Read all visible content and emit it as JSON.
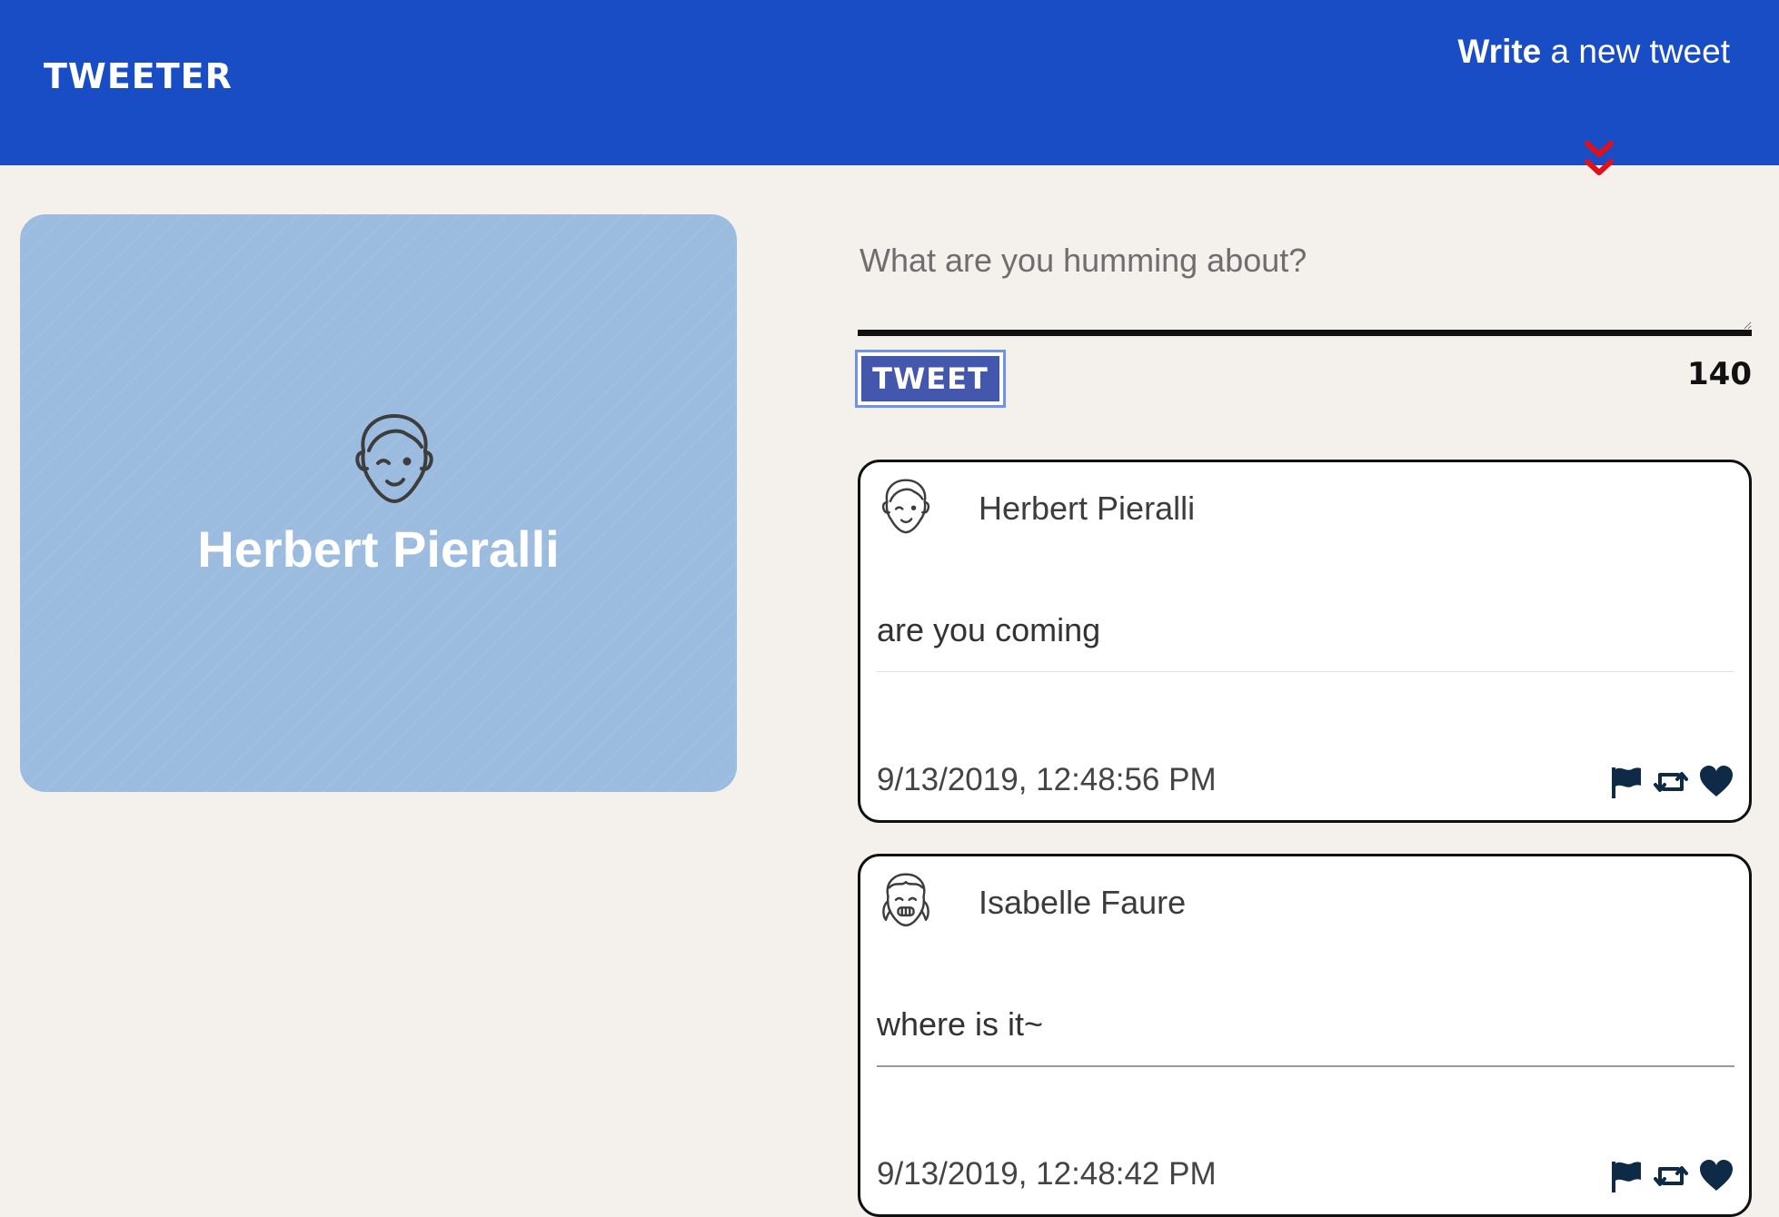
{
  "navbar": {
    "brand": "TWEETER",
    "compose_strong": "Write",
    "compose_rest": " a new tweet"
  },
  "profile": {
    "name": "Herbert Pieralli",
    "avatar_icon": "boy-face-icon"
  },
  "compose": {
    "placeholder": "What are you humming about?",
    "value": "",
    "submit_label": "TWEET",
    "counter": "140"
  },
  "tweets": [
    {
      "author": "Herbert Pieralli",
      "avatar_icon": "boy-face-icon",
      "text": "are you coming",
      "time": "9/13/2019, 12:48:56 PM",
      "actions": [
        "flag-icon",
        "retweet-icon",
        "heart-icon"
      ]
    },
    {
      "author": "Isabelle Faure",
      "avatar_icon": "girl-face-icon",
      "text": "where is it~",
      "time": "9/13/2019, 12:48:42 PM",
      "actions": [
        "flag-icon",
        "retweet-icon",
        "heart-icon"
      ]
    }
  ],
  "colors": {
    "navbar": "#184dc6",
    "page_background": "#f4f1ed",
    "profile_card": "#9bbbdf",
    "tweet_button": "#4357ad",
    "chevron": "#e0101a",
    "icon": "#0e2a47"
  }
}
